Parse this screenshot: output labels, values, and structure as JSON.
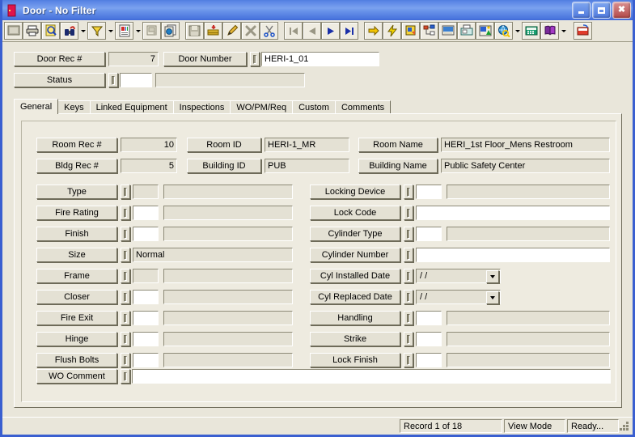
{
  "window": {
    "title": "Door - No Filter",
    "icon": "door-icon",
    "accent_titlebar": "#5b86e5",
    "face_color": "#e9e6da",
    "panel_color": "#eeebe0",
    "buttons": {
      "minimize": "minimize",
      "maximize": "maximize",
      "close": "close"
    }
  },
  "toolbar": {
    "items": [
      {
        "name": "screen-icon",
        "glyph": "screen",
        "framed": true,
        "dropdown": false
      },
      {
        "name": "print-icon",
        "glyph": "printer",
        "framed": true,
        "dropdown": false
      },
      {
        "name": "print-preview-icon",
        "glyph": "preview",
        "framed": true,
        "dropdown": false
      },
      {
        "name": "find-icon",
        "glyph": "binocular",
        "framed": true,
        "dropdown": true
      },
      {
        "name": "filter-icon",
        "glyph": "funnel",
        "framed": true,
        "dropdown": true
      },
      {
        "name": "report-icon",
        "glyph": "report",
        "framed": true,
        "dropdown": true
      },
      {
        "name": "properties-icon",
        "glyph": "props",
        "framed": true,
        "dropdown": false
      },
      {
        "name": "copy-record-icon",
        "glyph": "copyrec",
        "framed": true,
        "dropdown": false
      },
      {
        "name": "separator",
        "glyph": "sep",
        "framed": false,
        "dropdown": false
      },
      {
        "name": "save-icon",
        "glyph": "save",
        "framed": true,
        "dropdown": false
      },
      {
        "name": "add-record-icon",
        "glyph": "addrec",
        "framed": true,
        "dropdown": false
      },
      {
        "name": "edit-icon",
        "glyph": "pencil",
        "framed": true,
        "dropdown": false
      },
      {
        "name": "delete-icon",
        "glyph": "xmark",
        "framed": true,
        "dropdown": false
      },
      {
        "name": "cut-icon",
        "glyph": "scissors",
        "framed": true,
        "dropdown": false
      },
      {
        "name": "separator",
        "glyph": "sep",
        "framed": false,
        "dropdown": false
      },
      {
        "name": "first-record-icon",
        "glyph": "first",
        "framed": true,
        "dropdown": false
      },
      {
        "name": "previous-record-icon",
        "glyph": "prev",
        "framed": true,
        "dropdown": false
      },
      {
        "name": "next-record-icon",
        "glyph": "next",
        "framed": true,
        "dropdown": false
      },
      {
        "name": "last-record-icon",
        "glyph": "last",
        "framed": true,
        "dropdown": false
      },
      {
        "name": "separator",
        "glyph": "sep",
        "framed": false,
        "dropdown": false
      },
      {
        "name": "goto-icon",
        "glyph": "yarrow",
        "framed": true,
        "dropdown": false
      },
      {
        "name": "quick-action-icon",
        "glyph": "bolt",
        "framed": true,
        "dropdown": false
      },
      {
        "name": "linked-records-icon",
        "glyph": "linkrec",
        "framed": true,
        "dropdown": false
      },
      {
        "name": "hierarchy-icon",
        "glyph": "tree",
        "framed": true,
        "dropdown": false
      },
      {
        "name": "attachment-icon",
        "glyph": "attach",
        "framed": true,
        "dropdown": false
      },
      {
        "name": "fax-icon",
        "glyph": "fax",
        "framed": true,
        "dropdown": false
      },
      {
        "name": "image-icon",
        "glyph": "image",
        "framed": true,
        "dropdown": false
      },
      {
        "name": "web-search-icon",
        "glyph": "globe",
        "framed": true,
        "dropdown": true
      },
      {
        "name": "calculator-icon",
        "glyph": "calc",
        "framed": true,
        "dropdown": false
      },
      {
        "name": "help-book-icon",
        "glyph": "book",
        "framed": true,
        "dropdown": true
      },
      {
        "name": "separator",
        "glyph": "sep",
        "framed": false,
        "dropdown": false
      },
      {
        "name": "exit-icon",
        "glyph": "exit",
        "framed": true,
        "dropdown": false
      }
    ]
  },
  "header": {
    "door_rec_label": "Door Rec #",
    "door_rec_value": "7",
    "door_number_label": "Door Number",
    "door_number_value": "HERI-1_01",
    "status_label": "Status",
    "status_code_value": "",
    "status_desc_value": ""
  },
  "tabs": [
    {
      "label": "General",
      "active": true
    },
    {
      "label": "Keys",
      "active": false
    },
    {
      "label": "Linked Equipment",
      "active": false
    },
    {
      "label": "Inspections",
      "active": false
    },
    {
      "label": "WO/PM/Req",
      "active": false
    },
    {
      "label": "Custom",
      "active": false
    },
    {
      "label": "Comments",
      "active": false
    }
  ],
  "general": {
    "room_rec_label": "Room Rec #",
    "room_rec_value": "10",
    "room_id_label": "Room ID",
    "room_id_value": "HERI-1_MR",
    "room_name_label": "Room Name",
    "room_name_value": "HERI_1st Floor_Mens Restroom",
    "bldg_rec_label": "Bldg Rec #",
    "bldg_rec_value": "5",
    "building_id_label": "Building ID",
    "building_id_value": "PUB",
    "building_name_label": "Building Name",
    "building_name_value": "Public Safety Center",
    "left_fields": [
      {
        "label": "Type",
        "code": "",
        "desc": "",
        "code_white": false
      },
      {
        "label": "Fire Rating",
        "code": "",
        "desc": "",
        "code_white": true
      },
      {
        "label": "Finish",
        "code": "",
        "desc": "",
        "code_white": true
      }
    ],
    "size_label": "Size",
    "size_value": "Normal",
    "left_fields2": [
      {
        "label": "Frame",
        "code": "",
        "desc": "",
        "code_white": false
      },
      {
        "label": "Closer",
        "code": "",
        "desc": "",
        "code_white": true
      },
      {
        "label": "Fire Exit",
        "code": "",
        "desc": "",
        "code_white": true
      },
      {
        "label": "Hinge",
        "code": "",
        "desc": "",
        "code_white": true
      },
      {
        "label": "Flush Bolts",
        "code": "",
        "desc": "",
        "code_white": true
      }
    ],
    "right_fields1": [
      {
        "label": "Locking Device",
        "code": "",
        "desc": "",
        "code_white": true,
        "wide": false
      }
    ],
    "lock_code_label": "Lock Code",
    "lock_code_value": "",
    "cylinder_type_label": "Cylinder Type",
    "cylinder_type_value": "",
    "cylinder_number_label": "Cylinder Number",
    "cylinder_number_value": "",
    "cyl_installed_label": "Cyl Installed Date",
    "cyl_installed_value": "/  /",
    "cyl_replaced_label": "Cyl Replaced Date",
    "cyl_replaced_value": "/  /",
    "right_fields2": [
      {
        "label": "Handling",
        "code": "",
        "desc": "",
        "code_white": true
      },
      {
        "label": "Strike",
        "code": "",
        "desc": "",
        "code_white": true
      },
      {
        "label": "Lock Finish",
        "code": "",
        "desc": "",
        "code_white": true
      }
    ],
    "wo_comment_label": "WO Comment",
    "wo_comment_value": ""
  },
  "status_bar": {
    "record": "Record 1 of 18",
    "mode": "View Mode",
    "state": "Ready..."
  }
}
